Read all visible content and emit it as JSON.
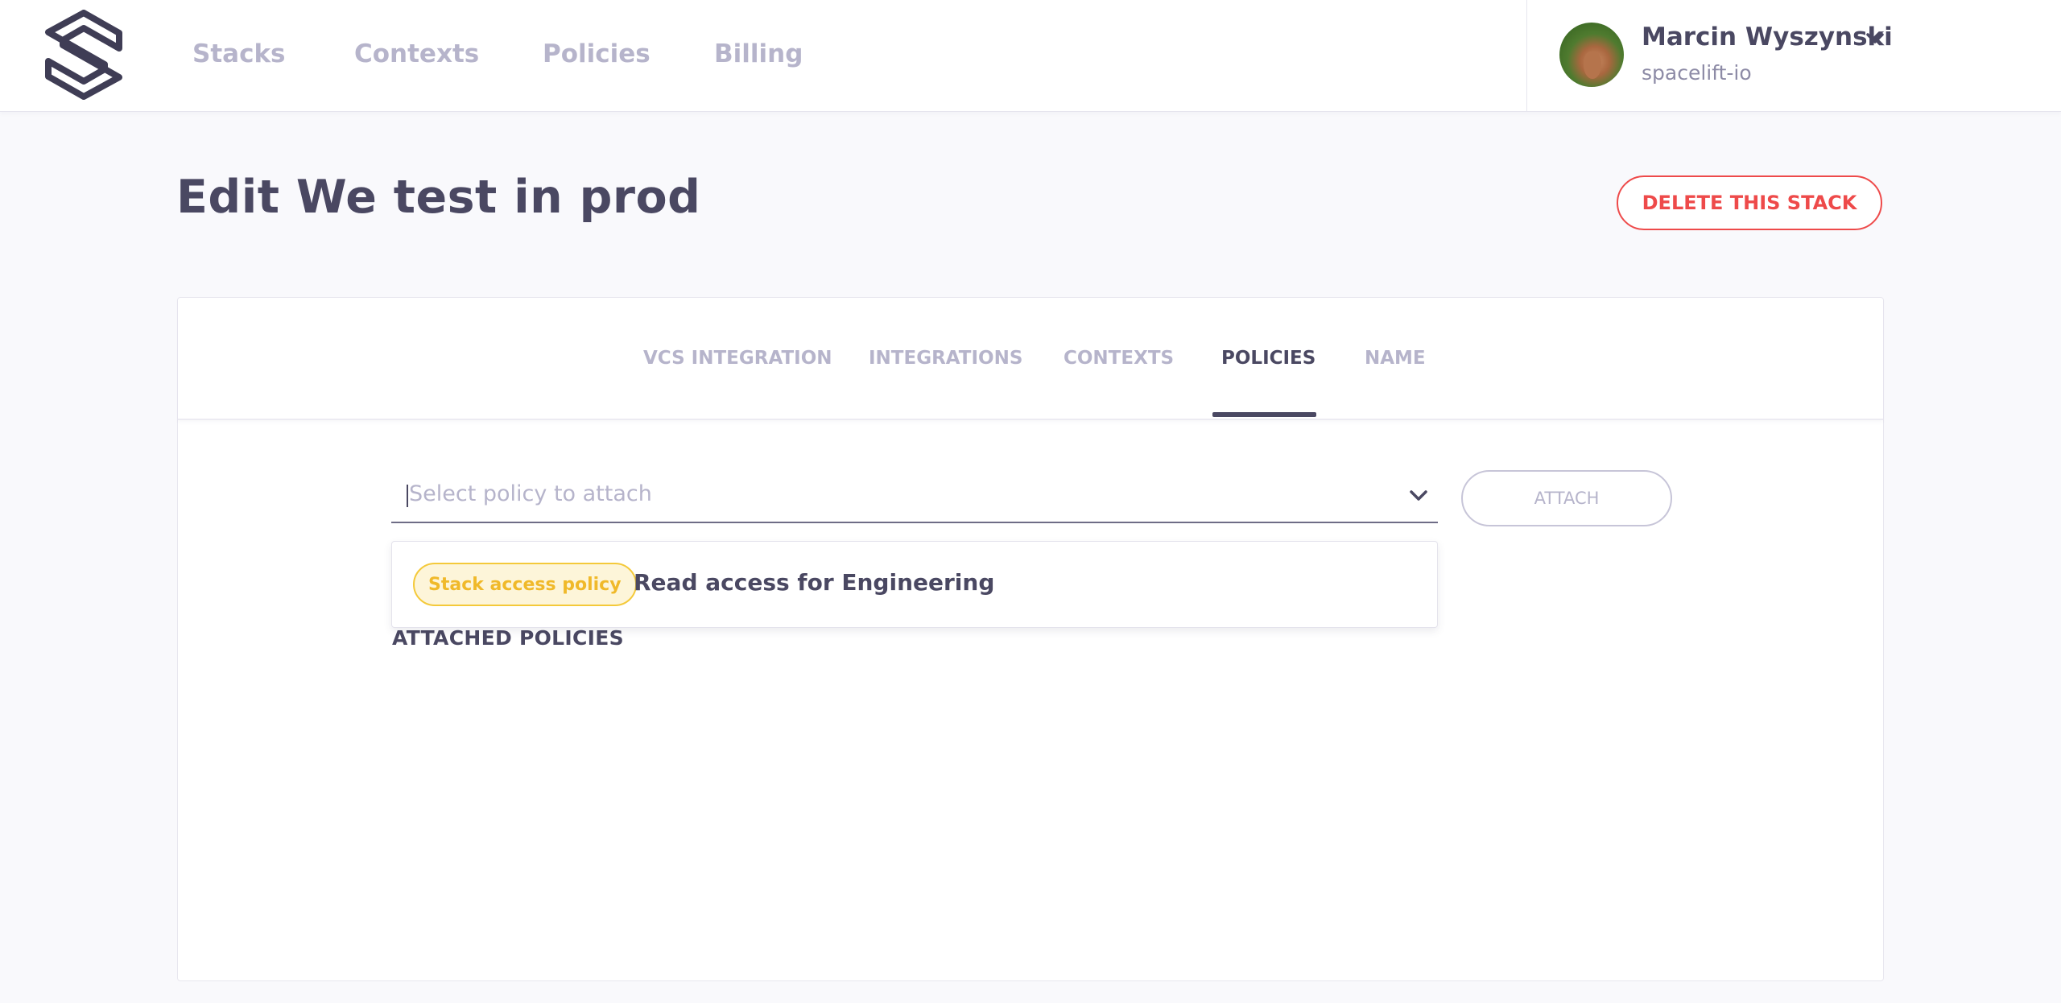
{
  "header": {
    "nav": [
      {
        "label": "Stacks"
      },
      {
        "label": "Contexts"
      },
      {
        "label": "Policies"
      },
      {
        "label": "Billing"
      }
    ],
    "user": {
      "name": "Marcin Wyszynski",
      "org": "spacelift-io"
    }
  },
  "page": {
    "title": "Edit We test in prod",
    "delete_label": "DELETE THIS STACK"
  },
  "tabs": [
    {
      "label": "VCS INTEGRATION",
      "active": false
    },
    {
      "label": "INTEGRATIONS",
      "active": false
    },
    {
      "label": "CONTEXTS",
      "active": false
    },
    {
      "label": "POLICIES",
      "active": true
    },
    {
      "label": "NAME",
      "active": false
    }
  ],
  "policy_select": {
    "placeholder": "Select policy to attach",
    "attach_label": "ATTACH",
    "options": [
      {
        "type": "Stack access policy",
        "name": "Read access for Engineering"
      }
    ]
  },
  "attached": {
    "heading": "ATTACHED POLICIES"
  },
  "colors": {
    "primary_text": "#4a4862",
    "muted_text": "#b6b4cb",
    "danger": "#ee4a4a",
    "badge_border": "#f4c93a",
    "badge_fill": "#fdf5d9",
    "badge_text": "#f0b92a",
    "background": "#f9f9fc"
  },
  "icons": {
    "logo": "spacelift-logo",
    "user_menu": "chevron-down-icon",
    "select_toggle": "chevron-down-icon"
  }
}
